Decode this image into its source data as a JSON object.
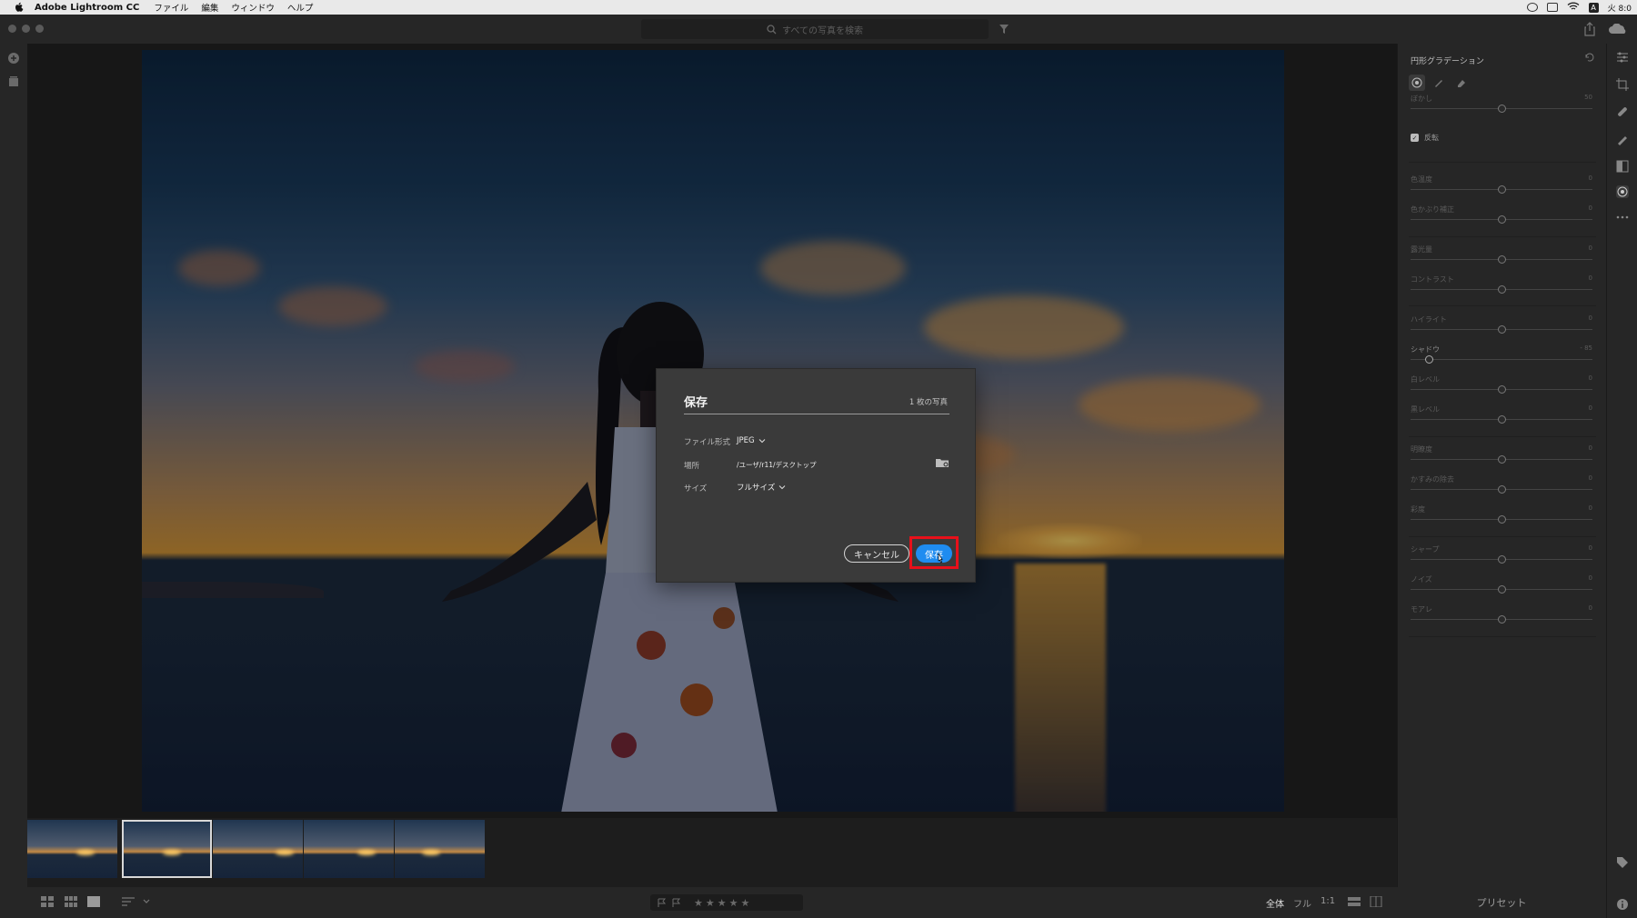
{
  "menubar": {
    "app": "Adobe Lightroom CC",
    "menus": [
      "ファイル",
      "編集",
      "ウィンドウ",
      "ヘルプ"
    ],
    "clock": "火 8:0"
  },
  "titlebar": {
    "search_placeholder": "すべての写真を検索"
  },
  "panel": {
    "title": "円形グラデーション",
    "feather": {
      "label": "ぼかし",
      "value": "50"
    },
    "invert_label": "反転",
    "sliders": [
      {
        "label": "色温度",
        "value": "0"
      },
      {
        "label": "色かぶり補正",
        "value": "0"
      },
      {
        "label": "露光量",
        "value": "0"
      },
      {
        "label": "コントラスト",
        "value": "0"
      },
      {
        "label": "ハイライト",
        "value": "0"
      },
      {
        "label": "シャドウ",
        "value": "- 85"
      },
      {
        "label": "白レベル",
        "value": "0"
      },
      {
        "label": "黒レベル",
        "value": "0"
      },
      {
        "label": "明瞭度",
        "value": "0"
      },
      {
        "label": "かすみの除去",
        "value": "0"
      },
      {
        "label": "彩度",
        "value": "0"
      },
      {
        "label": "シャープ",
        "value": "0"
      },
      {
        "label": "ノイズ",
        "value": "0"
      },
      {
        "label": "モアレ",
        "value": "0"
      }
    ]
  },
  "presets_label": "プリセット",
  "zoom": {
    "fit": "全体",
    "fill": "フル",
    "one": "1:1"
  },
  "rating": {
    "stars": "★★★★★"
  },
  "dialog": {
    "title": "保存",
    "count": "1 枚の写真",
    "format_label": "ファイル形式",
    "format_value": "JPEG",
    "location_label": "場所",
    "location_value": "/ユーザ/r11/デスクトップ",
    "size_label": "サイズ",
    "size_value": "フルサイズ",
    "cancel_label": "キャンセル",
    "save_label": "保存"
  },
  "colors": {
    "accent": "#1f8cf0",
    "highlight": "#e8101a"
  }
}
